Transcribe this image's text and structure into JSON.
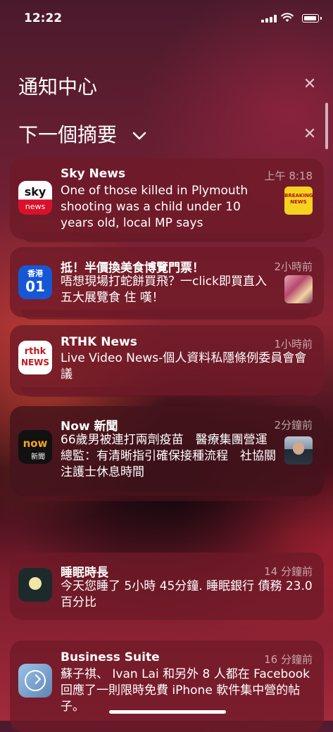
{
  "status": {
    "time": "12:22"
  },
  "center_title": "通知中心",
  "summary_title": "下一個摘要",
  "notifications": [
    {
      "app": "Sky News",
      "time": "上午 8:18",
      "body": "One of those killed in Plymouth shooting was a child under 10 years old, local MP says",
      "icon_text_top": "sky",
      "icon_text_bottom": "news",
      "thumb_text": "BREAKING NEWS"
    },
    {
      "app": "抵！半價換美食博覽門票！",
      "time": "2小時前",
      "body": "唔想現場打蛇餅買飛？一click即買直入五大展覽食 住 嘆！",
      "icon_text_top": "香港",
      "icon_text_bottom": "01"
    },
    {
      "app": "RTHK News",
      "time": "1小時前",
      "body": "Live Video News-個人資料私隱條例委員會會議",
      "icon_text_top": "rthk",
      "icon_text_bottom": "NEWS"
    },
    {
      "app": "Now 新聞",
      "time": "2分鐘前",
      "body": "66歲男被連打兩劑疫苗　醫療集團營運總監：有清晰指引確保接種流程　社協關注護士休息時間",
      "icon_text_top": "now",
      "icon_text_bottom": "新聞"
    },
    {
      "app": "睡眠時長",
      "time": "14 分鐘前",
      "body": "今天您睡了 5小時 45分鐘. 睡眠銀行 債務 23.0 百分比"
    },
    {
      "app": "Business Suite",
      "time": "16 分鐘前",
      "body": "蘇子祺、 Ivan Lai 和另外 8 人都在 Facebook 回應了一則限時免費 iPhone 軟件集中營的帖子。"
    }
  ]
}
